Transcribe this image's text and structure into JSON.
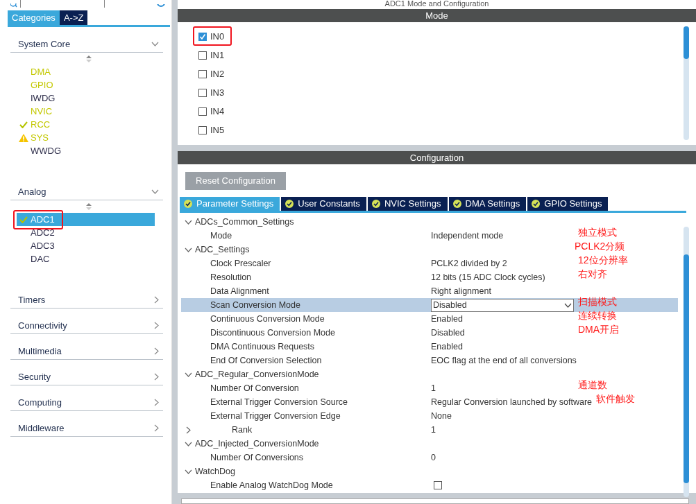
{
  "sidebar": {
    "tabs": [
      {
        "label": "Categories",
        "selected": true
      },
      {
        "label": "A->Z",
        "selected": false
      }
    ],
    "groups": [
      {
        "label": "System Core",
        "expanded": true,
        "items": [
          {
            "label": "DMA",
            "configured": true,
            "ok": false,
            "warning": false,
            "selected": false,
            "marked": false
          },
          {
            "label": "GPIO",
            "configured": true,
            "ok": false,
            "warning": false,
            "selected": false,
            "marked": false
          },
          {
            "label": "IWDG",
            "configured": false,
            "ok": false,
            "warning": false,
            "selected": false,
            "marked": false
          },
          {
            "label": "NVIC",
            "configured": true,
            "ok": false,
            "warning": false,
            "selected": false,
            "marked": false
          },
          {
            "label": "RCC",
            "configured": true,
            "ok": true,
            "warning": false,
            "selected": false,
            "marked": false
          },
          {
            "label": "SYS",
            "configured": true,
            "ok": false,
            "warning": true,
            "selected": false,
            "marked": false
          },
          {
            "label": "WWDG",
            "configured": false,
            "ok": false,
            "warning": false,
            "selected": false,
            "marked": false
          }
        ]
      },
      {
        "label": "Analog",
        "expanded": true,
        "items": [
          {
            "label": "ADC1",
            "configured": true,
            "ok": true,
            "warning": false,
            "selected": true,
            "marked": true
          },
          {
            "label": "ADC2",
            "configured": false,
            "ok": false,
            "warning": false,
            "selected": false,
            "marked": false
          },
          {
            "label": "ADC3",
            "configured": false,
            "ok": false,
            "warning": false,
            "selected": false,
            "marked": false
          },
          {
            "label": "DAC",
            "configured": false,
            "ok": false,
            "warning": false,
            "selected": false,
            "marked": false
          }
        ]
      },
      {
        "label": "Timers",
        "expanded": false
      },
      {
        "label": "Connectivity",
        "expanded": false
      },
      {
        "label": "Multimedia",
        "expanded": false
      },
      {
        "label": "Security",
        "expanded": false
      },
      {
        "label": "Computing",
        "expanded": false
      },
      {
        "label": "Middleware",
        "expanded": false
      }
    ]
  },
  "panel_title": "ADC1 Mode and Configuration",
  "mode": {
    "title": "Mode",
    "channels": [
      {
        "label": "IN0",
        "checked": true,
        "marked": true
      },
      {
        "label": "IN1",
        "checked": false,
        "marked": false
      },
      {
        "label": "IN2",
        "checked": false,
        "marked": false
      },
      {
        "label": "IN3",
        "checked": false,
        "marked": false
      },
      {
        "label": "IN4",
        "checked": false,
        "marked": false
      },
      {
        "label": "IN5",
        "checked": false,
        "marked": false
      }
    ]
  },
  "configuration": {
    "title": "Configuration",
    "reset_button": {
      "label": "Reset Configuration",
      "disabled": true
    },
    "tabs": [
      {
        "label": "Parameter Settings",
        "selected": true
      },
      {
        "label": "User Constants",
        "selected": false
      },
      {
        "label": "NVIC Settings",
        "selected": false
      },
      {
        "label": "DMA Settings",
        "selected": false
      },
      {
        "label": "GPIO Settings",
        "selected": false
      }
    ],
    "parameters": [
      {
        "label": "ADCs_Common_Settings",
        "expanded": true,
        "children": [
          {
            "label": "Mode",
            "value": "Independent mode",
            "kind": "text",
            "selected": false,
            "note": "独立模式"
          }
        ]
      },
      {
        "label": "ADC_Settings",
        "expanded": true,
        "note": "PCLK2分频",
        "children": [
          {
            "label": "Clock Prescaler",
            "value": "PCLK2 divided by 2",
            "kind": "text",
            "selected": false,
            "note": "12位分辨率"
          },
          {
            "label": "Resolution",
            "value": "12 bits (15 ADC Clock cycles)",
            "kind": "text",
            "selected": false,
            "note": "右对齐"
          },
          {
            "label": "Data Alignment",
            "value": "Right alignment",
            "kind": "text",
            "selected": false
          },
          {
            "label": "Scan Conversion Mode",
            "value": "Disabled",
            "kind": "dropdown",
            "selected": true,
            "note": "扫描模式"
          },
          {
            "label": "Continuous Conversion Mode",
            "value": "Enabled",
            "kind": "text",
            "selected": false,
            "note": "连续转换"
          },
          {
            "label": "Discontinuous Conversion Mode",
            "value": "Disabled",
            "kind": "text",
            "selected": false,
            "note": "DMA开启"
          },
          {
            "label": "DMA Continuous Requests",
            "value": "Enabled",
            "kind": "text",
            "selected": false
          },
          {
            "label": "End Of Conversion Selection",
            "value": "EOC flag at the end of all conversions",
            "kind": "text",
            "selected": false
          }
        ]
      },
      {
        "label": "ADC_Regular_ConversionMode",
        "expanded": true,
        "children": [
          {
            "label": "Number Of Conversion",
            "value": "1",
            "kind": "text",
            "selected": false,
            "note": "通道数"
          },
          {
            "label": "External Trigger Conversion Source",
            "value": "Regular Conversion launched by software",
            "kind": "text",
            "selected": false,
            "note": "软件触发"
          },
          {
            "label": "External Trigger Conversion Edge",
            "value": "None",
            "kind": "text",
            "selected": false
          },
          {
            "label": "Rank",
            "value": "1",
            "kind": "node",
            "expanded": false,
            "selected": false
          }
        ]
      },
      {
        "label": "ADC_Injected_ConversionMode",
        "expanded": true,
        "children": [
          {
            "label": "Number Of Conversions",
            "value": "0",
            "kind": "text",
            "selected": false
          }
        ]
      },
      {
        "label": "WatchDog",
        "expanded": true,
        "children": [
          {
            "label": "Enable Analog WatchDog Mode",
            "checked": false,
            "kind": "checkbox",
            "selected": false
          }
        ]
      }
    ]
  }
}
